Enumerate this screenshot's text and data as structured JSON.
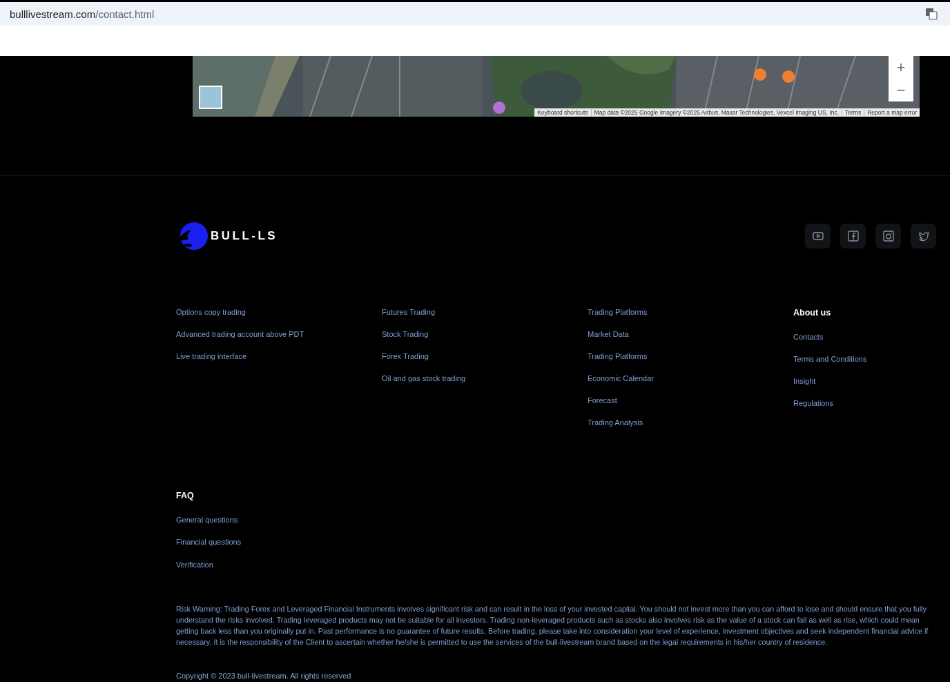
{
  "browser": {
    "url_host": "bulllivestream.com",
    "url_path": "/contact.html"
  },
  "map": {
    "zoom_in": "+",
    "zoom_out": "−",
    "attribution": [
      "Keyboard shortcuts",
      "Map data ©2025 Google Imagery ©2025 Airbus, Maxar Technologies, Vexcel Imaging US, Inc.",
      "Terms",
      "Report a map error"
    ]
  },
  "footer": {
    "brand": "BULL-LS",
    "link_columns": [
      {
        "links": [
          "Options copy trading",
          "Advanced trading account above PDT",
          "Live trading interface"
        ]
      },
      {
        "links": [
          "Futures Trading",
          "Stock Trading",
          "Forex Trading",
          "Oil and gas stock trading"
        ]
      },
      {
        "links": [
          "Trading Platforms",
          "Market Data",
          "Trading Platforms",
          "Economic Calendar",
          "Forecast",
          "Trading Analysis"
        ]
      },
      {
        "heading": "About us",
        "links": [
          "Contacts",
          "Terms and Conditions",
          "Insight",
          "Regulations"
        ]
      }
    ],
    "faq": {
      "heading": "FAQ",
      "links": [
        "General questions",
        "Financial questions",
        "Verification"
      ]
    },
    "risk_warning": "Risk Warning: Trading Forex and Leveraged Financial Instruments involves significant risk and can result in the loss of your invested capital. You should not invest more than you can afford to lose and should ensure that you fully understand the risks involved. Trading leveraged products may not be suitable for all investors. Trading non-leveraged products such as stocks also involves risk as the value of a stock can fall as well as rise, which could mean getting back less than you originally put in. Past performance is no guarantee of future results. Before trading, please take into consideration your level of experience, investment objectives and seek independent financial advice if necessary. It is the responsibility of the Client to ascertain whether he/she is permitted to use the services of the bull-livestream brand based on the legal requirements in his/her country of residence.",
    "copyright": "Copyright © 2023 bull-livestream. All rights reserved"
  }
}
